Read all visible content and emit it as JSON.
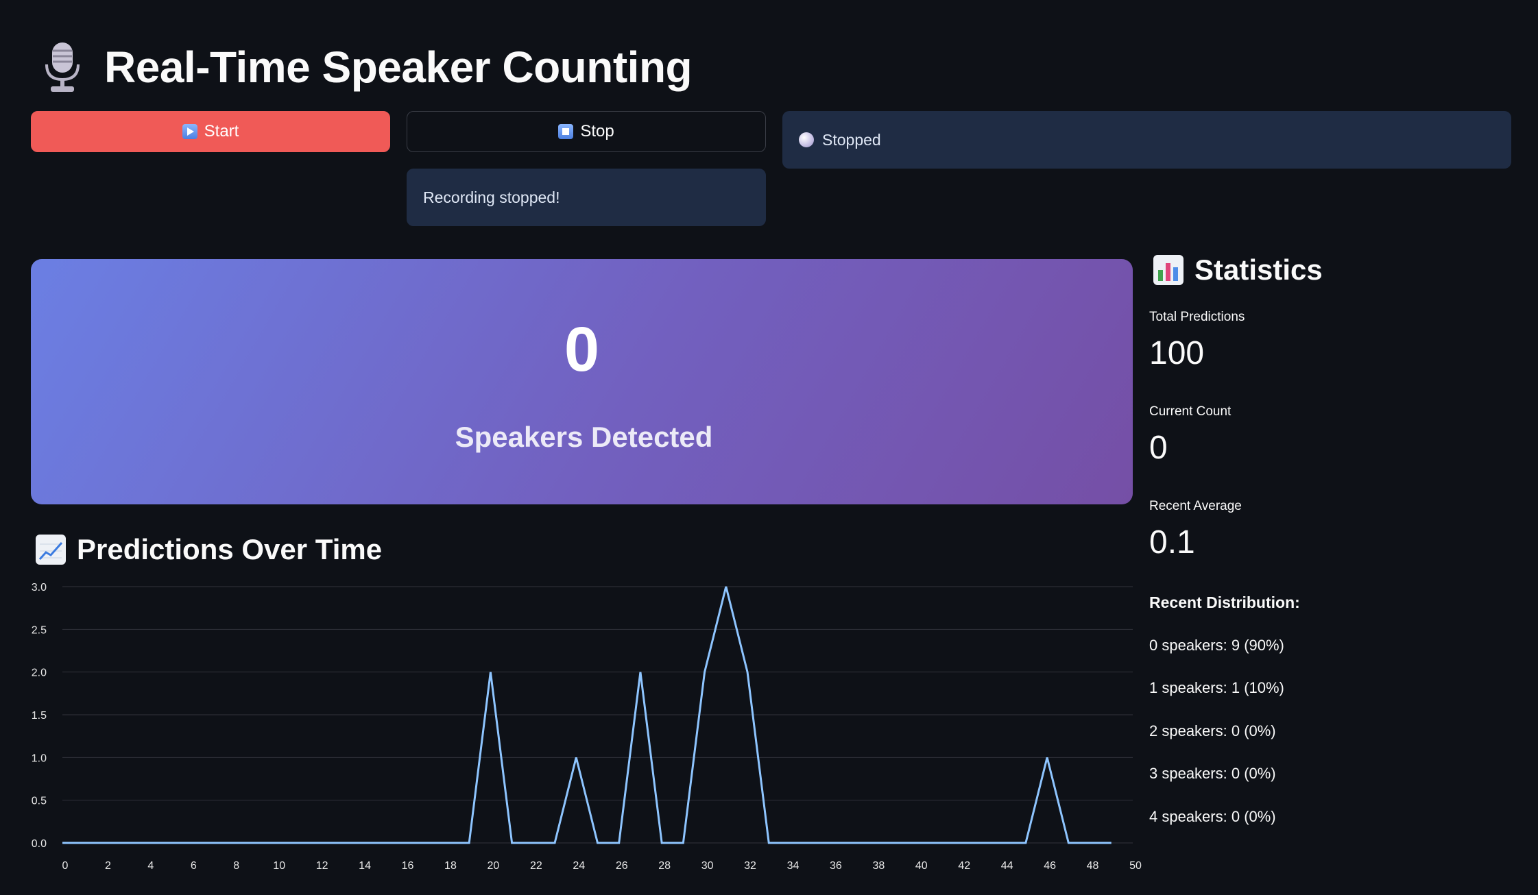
{
  "header": {
    "title": "Real-Time Speaker Counting",
    "icon": "microphone-icon"
  },
  "controls": {
    "start_label": "Start",
    "stop_label": "Stop",
    "recording_message": "Recording stopped!",
    "status_text": "Stopped"
  },
  "hero": {
    "count": "0",
    "label": "Speakers Detected"
  },
  "chart_section": {
    "title": "Predictions Over Time",
    "icon": "line-chart-icon"
  },
  "stats": {
    "title": "Statistics",
    "icon": "bar-chart-icon",
    "metrics": [
      {
        "label": "Total Predictions",
        "value": "100"
      },
      {
        "label": "Current Count",
        "value": "0"
      },
      {
        "label": "Recent Average",
        "value": "0.1"
      }
    ],
    "distribution_title": "Recent Distribution:",
    "distribution": [
      "0 speakers: 9 (90%)",
      "1 speakers: 1 (10%)",
      "2 speakers: 0 (0%)",
      "3 speakers: 0 (0%)",
      "4 speakers: 0 (0%)"
    ]
  },
  "colors": {
    "background": "#0e1117",
    "start_button": "#f05a57",
    "alert_bg": "#1f2c44",
    "line": "#8ec5ff",
    "hero_gradient": [
      "#6b7fe3",
      "#754fa6"
    ]
  },
  "chart_data": {
    "type": "line",
    "x": [
      0,
      1,
      2,
      3,
      4,
      5,
      6,
      7,
      8,
      9,
      10,
      11,
      12,
      13,
      14,
      15,
      16,
      17,
      18,
      19,
      20,
      21,
      22,
      23,
      24,
      25,
      26,
      27,
      28,
      29,
      30,
      31,
      32,
      33,
      34,
      35,
      36,
      37,
      38,
      39,
      40,
      41,
      42,
      43,
      44,
      45,
      46,
      47,
      48,
      49
    ],
    "series": [
      {
        "values": [
          0,
          0,
          0,
          0,
          0,
          0,
          0,
          0,
          0,
          0,
          0,
          0,
          0,
          0,
          0,
          0,
          0,
          0,
          0,
          0,
          2,
          0,
          0,
          0,
          1,
          0,
          0,
          2,
          0,
          0,
          2,
          3,
          2,
          0,
          0,
          0,
          0,
          0,
          0,
          0,
          0,
          0,
          0,
          0,
          0,
          0,
          1,
          0,
          0,
          0
        ]
      }
    ],
    "xlim": [
      0,
      50
    ],
    "ylim": [
      0,
      3
    ],
    "xticks": [
      0,
      2,
      4,
      6,
      8,
      10,
      12,
      14,
      16,
      18,
      20,
      22,
      24,
      26,
      28,
      30,
      32,
      34,
      36,
      38,
      40,
      42,
      44,
      46,
      48,
      50
    ],
    "yticks": [
      "0.0",
      "0.5",
      "1.0",
      "1.5",
      "2.0",
      "2.5",
      "3.0"
    ],
    "grid": true,
    "title": "",
    "xlabel": "",
    "ylabel": ""
  }
}
